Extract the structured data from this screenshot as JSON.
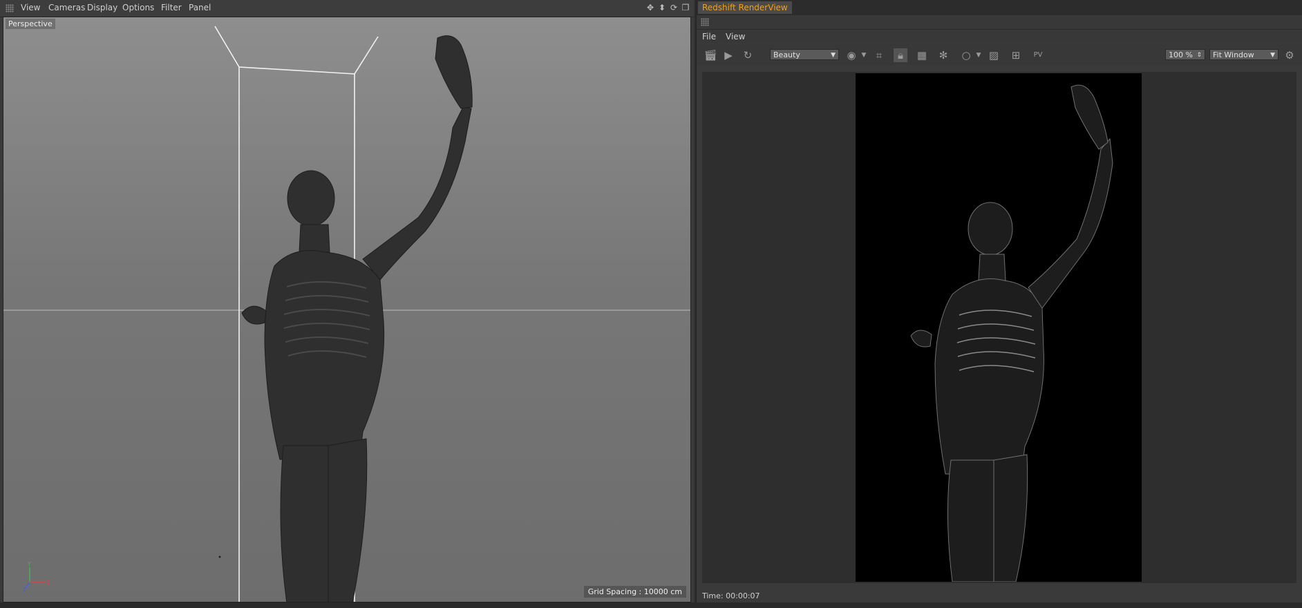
{
  "viewport_panel": {
    "menu": [
      "View",
      "Cameras",
      "Display",
      "Options",
      "Filter",
      "Panel"
    ],
    "nav_icons": [
      "move-icon",
      "dolly-icon",
      "rotate-icon",
      "maximize-icon"
    ],
    "view_label": "Perspective",
    "grid_spacing": "Grid Spacing : 10000 cm",
    "axis": {
      "x": "X",
      "y": "Y",
      "z": "Z"
    }
  },
  "render_view": {
    "title": "Redshift RenderView",
    "menu": [
      "File",
      "View"
    ],
    "aov_select": "Beauty",
    "zoom_value": "100 %",
    "fit_mode": "Fit Window",
    "status_time": "Time: 00:00:07",
    "toolbar_icons": [
      "clapper-icon",
      "play-icon",
      "refresh-icon",
      "rgb-icon",
      "crop-icon",
      "lock-icon",
      "grid-icon",
      "snowflake-icon",
      "circle-icon",
      "image-icon",
      "add-snapshot-icon",
      "pv-icon",
      "settings-gear-icon"
    ]
  },
  "colors": {
    "accent": "#f0a020",
    "panel": "#3a3a3a",
    "viewport_top": "#8e8e8e",
    "render_bg": "#000000"
  }
}
